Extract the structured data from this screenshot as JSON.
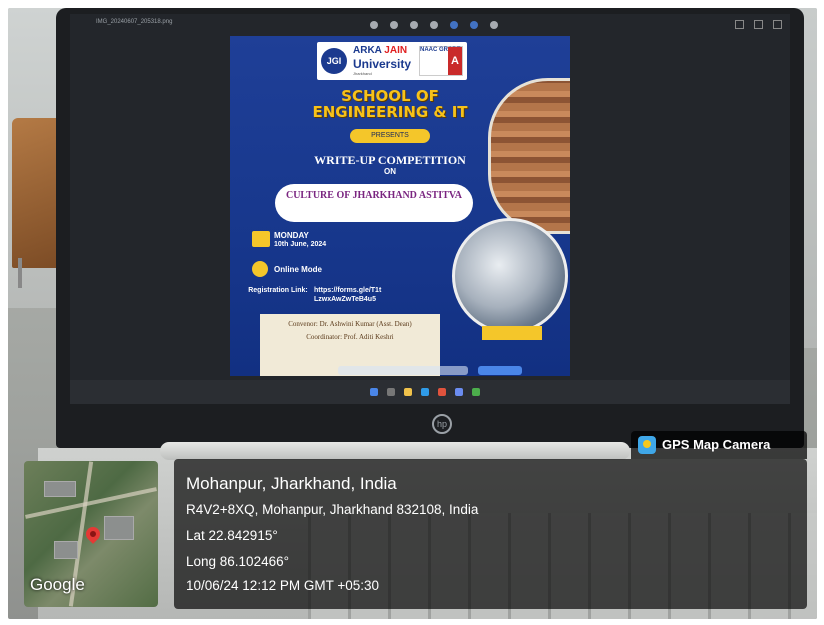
{
  "screen": {
    "file_name": "IMG_20240607_205318.png",
    "poster": {
      "university_line1_a": "ARKA",
      "university_line1_b": "JAIN",
      "university_line2": "University",
      "university_line3": "Jharkhand",
      "logo": "JGI",
      "naac": "NAAC GRADE",
      "naac_grade": "A",
      "school": "SCHOOL OF ENGINEERING & IT",
      "presents": "PRESENTS",
      "competition": "WRITE-UP COMPETITION",
      "on": "ON",
      "topic": "CULTURE OF JHARKHAND ASTITVA",
      "day": "MONDAY",
      "date": "10th June, 2024",
      "mode": "Online Mode",
      "registration_label": "Registration Link:",
      "registration_link": "https://forms.gle/T1t LzwxAwZwTeB4u5",
      "convenor": "Convenor: Dr. Ashwini Kumar (Asst. Dean)",
      "coordinator": "Coordinator: Prof. Aditi Keshri"
    }
  },
  "overlay": {
    "app_name": "GPS Map Camera",
    "place": "Mohanpur, Jharkhand, India",
    "address": "R4V2+8XQ, Mohanpur, Jharkhand 832108, India",
    "lat": "Lat 22.842915°",
    "long": "Long 86.102466°",
    "datetime": "10/06/24 12:12 PM GMT +05:30",
    "map_label": "Google"
  },
  "colors": {
    "poster_blue": "#1f3f97",
    "poster_yellow": "#f4c62a",
    "overlay_bg": "#000000"
  },
  "icons": [
    "gps-camera-icon",
    "map-pin-icon",
    "calendar-icon",
    "location-icon",
    "hp-logo-icon"
  ]
}
